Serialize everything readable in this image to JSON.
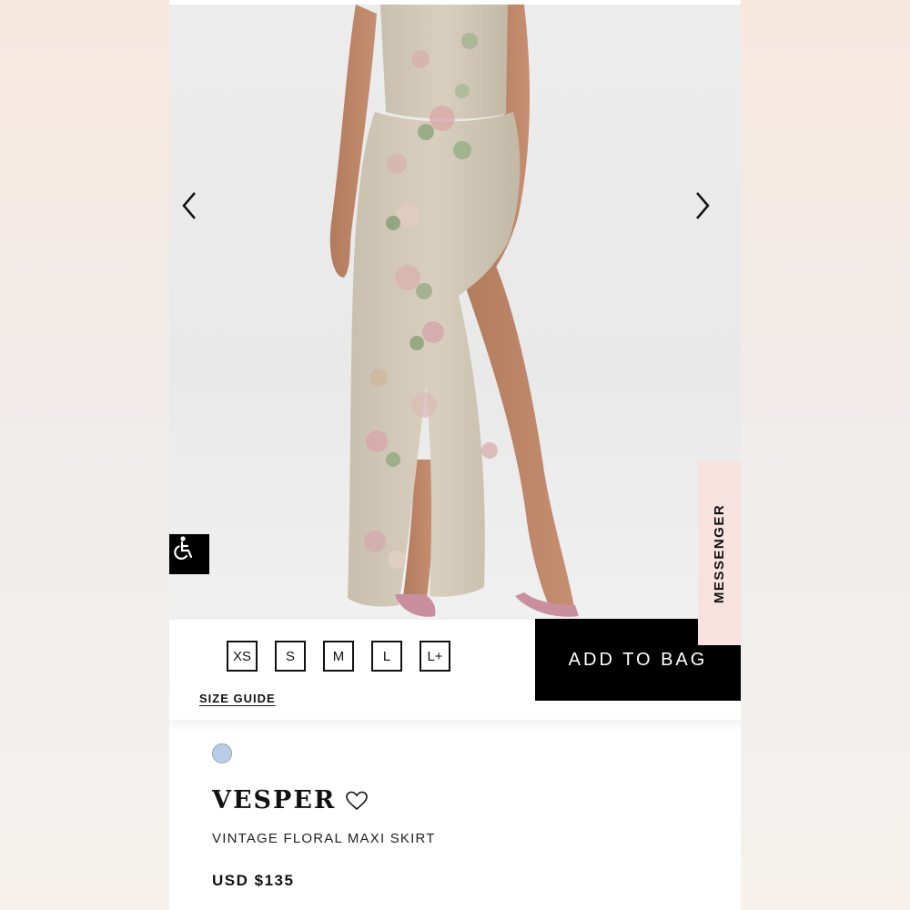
{
  "product": {
    "name": "VESPER",
    "subtitle": "VINTAGE FLORAL MAXI SKIRT",
    "price": "USD $135",
    "color_swatch": "#b9cde6"
  },
  "gallery": {
    "prev_icon": "chevron-left-icon",
    "next_icon": "chevron-right-icon"
  },
  "sizes": [
    "XS",
    "S",
    "M",
    "L",
    "L+"
  ],
  "size_guide_label": "SIZE GUIDE",
  "add_to_bag_label": "ADD TO BAG",
  "messenger_label": "MESSENGER",
  "accessibility_icon": "wheelchair-icon",
  "favorite_icon": "heart-icon",
  "colors": {
    "button_bg": "#000000",
    "messenger_bg": "#f7e2df"
  }
}
